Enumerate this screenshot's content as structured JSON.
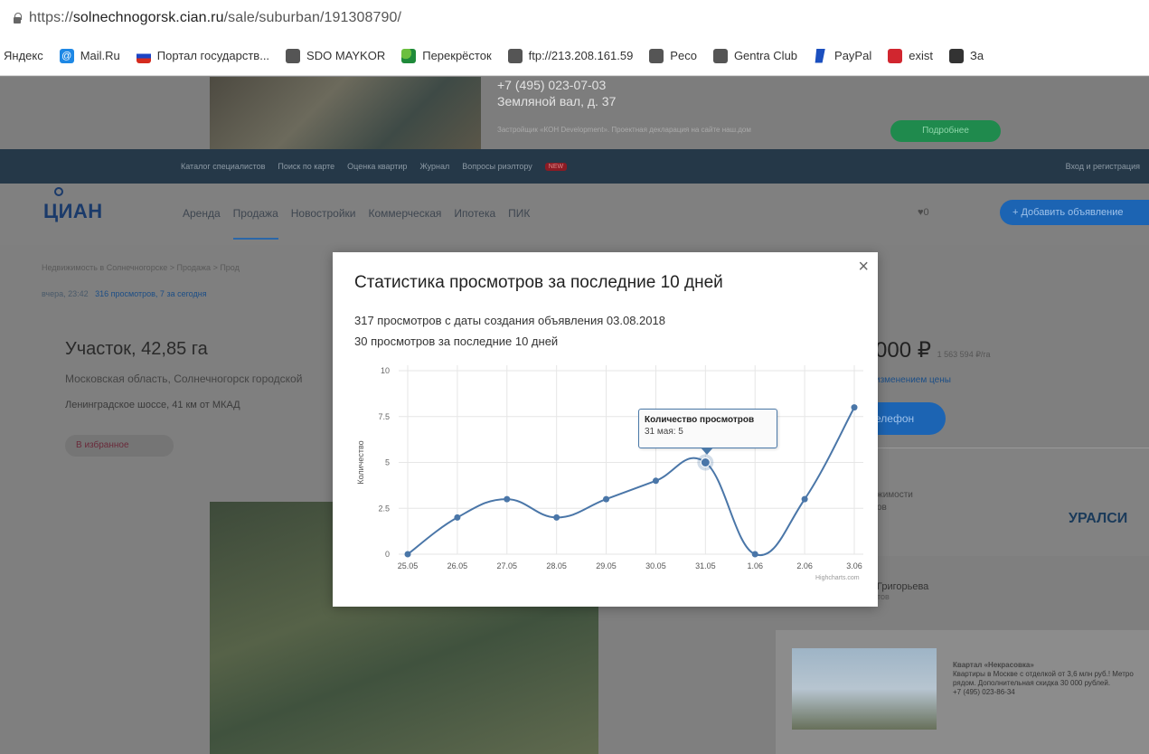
{
  "browser": {
    "url_prefix": "https://",
    "url_host": "solnechnogorsk.cian.ru",
    "url_path": "/sale/suburban/191308790/",
    "bookmarks": [
      "Яндекс",
      "Mail.Ru",
      "Портал государств...",
      "SDO MAYKOR",
      "Перекрёсток",
      "ftp://213.208.161.59",
      "Peco",
      "Gentra Club",
      "PayPal",
      "exist",
      "За"
    ]
  },
  "page": {
    "banner_address_1": "+7 (495) 023-07-03",
    "banner_address_2": "Земляной вал, д. 37",
    "banner_dev": "Застройщик «КОН Development». Проектная декларация на сайте наш.дом",
    "banner_more": "Подробнее",
    "topnav": [
      "Каталог специалистов",
      "Поиск по карте",
      "Оценка квартир",
      "Журнал",
      "Вопросы риэлтору"
    ],
    "topnav_new": "NEW",
    "login": "Вход и регистрация",
    "logo": "ЦИАН",
    "menu": [
      "Аренда",
      "Продажа",
      "Новостройки",
      "Коммерческая",
      "Ипотека",
      "ПИК"
    ],
    "fav_count": "♥0",
    "add_button": "+ Добавить объявление",
    "breadcrumbs": "Недвижимость в Солнечногорске > Продажа > Прод",
    "date": "вчера, 23:42",
    "views": "316 просмотров, 7 за сегодня",
    "title": "Участок, 42,85 га",
    "region": "Московская область, Солнечногорск городской",
    "highway": "Ленинградское шоссе, 41 км от МКАД",
    "fav_button": "В избранное",
    "price": "000 ₽",
    "price_per": "1 563 594 ₽/га",
    "price_change": "изменением цены",
    "phone": "елефон",
    "side_text": "жимости",
    "side_text2": "ов",
    "developer_logo": "УРАЛСИ",
    "agent": "Григорьева",
    "agent2": "тов",
    "ad_title": "Квартал «Некрасовка»",
    "ad_text": "Квартиры в Москве с отделкой от 3,6 млн руб.! Метро рядом. Дополнительная скидка 30 000 рублей.",
    "ad_phone": "+7 (495) 023-86-34"
  },
  "modal": {
    "title": "Статистика просмотров за последние 10 дней",
    "line1": "317 просмотров с даты создания объявления 03.08.2018",
    "line2": "30 просмотров за последние 10 дней",
    "close": "×",
    "tooltip_title": "Количество просмотров",
    "tooltip_value": "31 мая: 5",
    "credit": "Highcharts.com"
  },
  "chart_data": {
    "type": "line",
    "categories": [
      "25.05",
      "26.05",
      "27.05",
      "28.05",
      "29.05",
      "30.05",
      "31.05",
      "1.06",
      "2.06",
      "3.06"
    ],
    "values": [
      0,
      2,
      3,
      2,
      3,
      4,
      5,
      0,
      3,
      8
    ],
    "ylabel": "Количество",
    "xlabel": "",
    "ylim": [
      0,
      10
    ],
    "yticks": [
      "0",
      "2.5",
      "5",
      "7.5",
      "10"
    ],
    "highlight_index": 6,
    "grid": true,
    "color": "#4a76a8"
  }
}
